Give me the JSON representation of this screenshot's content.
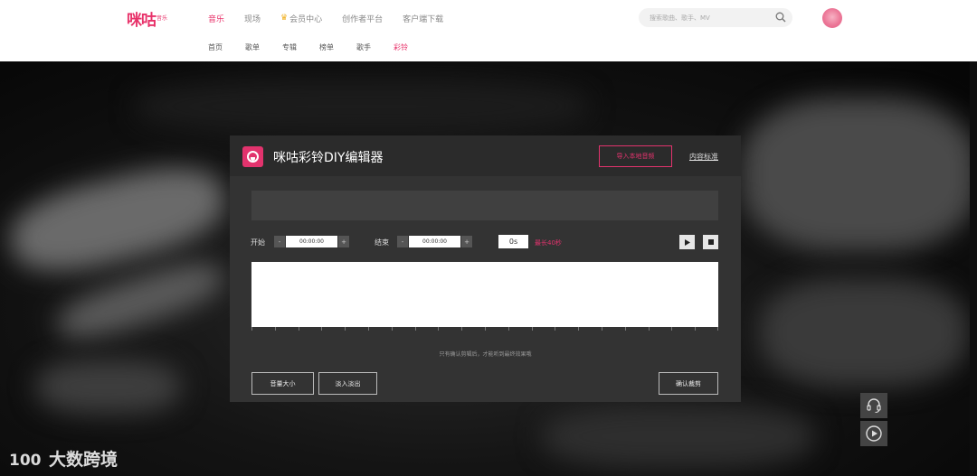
{
  "header": {
    "logo_main": "咪咕",
    "logo_sub": "音乐",
    "nav": [
      {
        "label": "音乐",
        "active": true
      },
      {
        "label": "现场",
        "active": false
      },
      {
        "label": "会员中心",
        "active": false,
        "icon": "crown-icon"
      },
      {
        "label": "创作者平台",
        "active": false
      },
      {
        "label": "客户端下载",
        "active": false
      }
    ],
    "search_placeholder": "搜索歌曲、歌手、MV",
    "subnav": [
      {
        "label": "首页",
        "active": false
      },
      {
        "label": "歌单",
        "active": false
      },
      {
        "label": "专辑",
        "active": false
      },
      {
        "label": "榜单",
        "active": false
      },
      {
        "label": "歌手",
        "active": false
      },
      {
        "label": "彩铃",
        "active": true
      }
    ]
  },
  "editor": {
    "title": "咪咕彩铃DIY编辑器",
    "import_label": "导入本地音频",
    "standard_label": "内容标准",
    "start_label": "开始",
    "end_label": "结束",
    "start_time": "00:00:00",
    "end_time": "00:00:00",
    "minus": "-",
    "plus": "+",
    "duration": "0s",
    "duration_note": "最长40秒",
    "hint": "只有确认剪辑后，才能听到最终效果哦",
    "volume_label": "音量大小",
    "fade_label": "淡入淡出",
    "confirm_label": "确认裁剪"
  },
  "watermark": {
    "logo": "100",
    "text": "大数跨境"
  },
  "colors": {
    "brand": "#e8326a",
    "panel": "#333333",
    "panel_header": "#2b2b2b"
  }
}
